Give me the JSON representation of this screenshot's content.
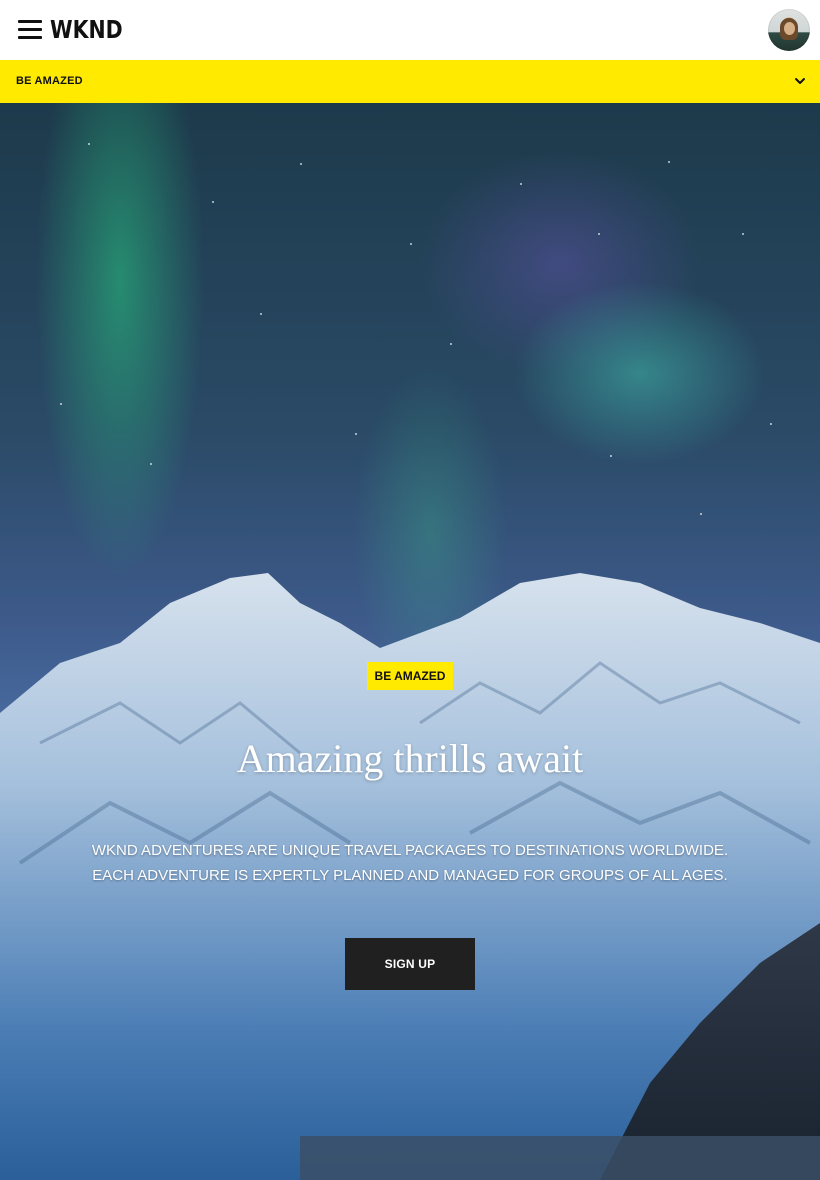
{
  "header": {
    "logo_text": "WKND",
    "menu_icon": "hamburger-menu-icon",
    "avatar_icon": "user-avatar"
  },
  "subnav": {
    "label": "BE AMAZED",
    "chevron_icon": "chevron-down-icon"
  },
  "hero": {
    "badge": "BE AMAZED",
    "title": "Amazing thrills await",
    "description_line1": "WKND ADVENTURES ARE UNIQUE TRAVEL PACKAGES TO DESTINATIONS WORLDWIDE.",
    "description_line2": "EACH ADVENTURE IS EXPERTLY PLANNED AND MANAGED FOR GROUPS OF ALL AGES.",
    "cta_label": "SIGN UP"
  },
  "colors": {
    "accent_yellow": "#ffea00",
    "button_dark": "#202020",
    "text_dark": "#111111"
  }
}
